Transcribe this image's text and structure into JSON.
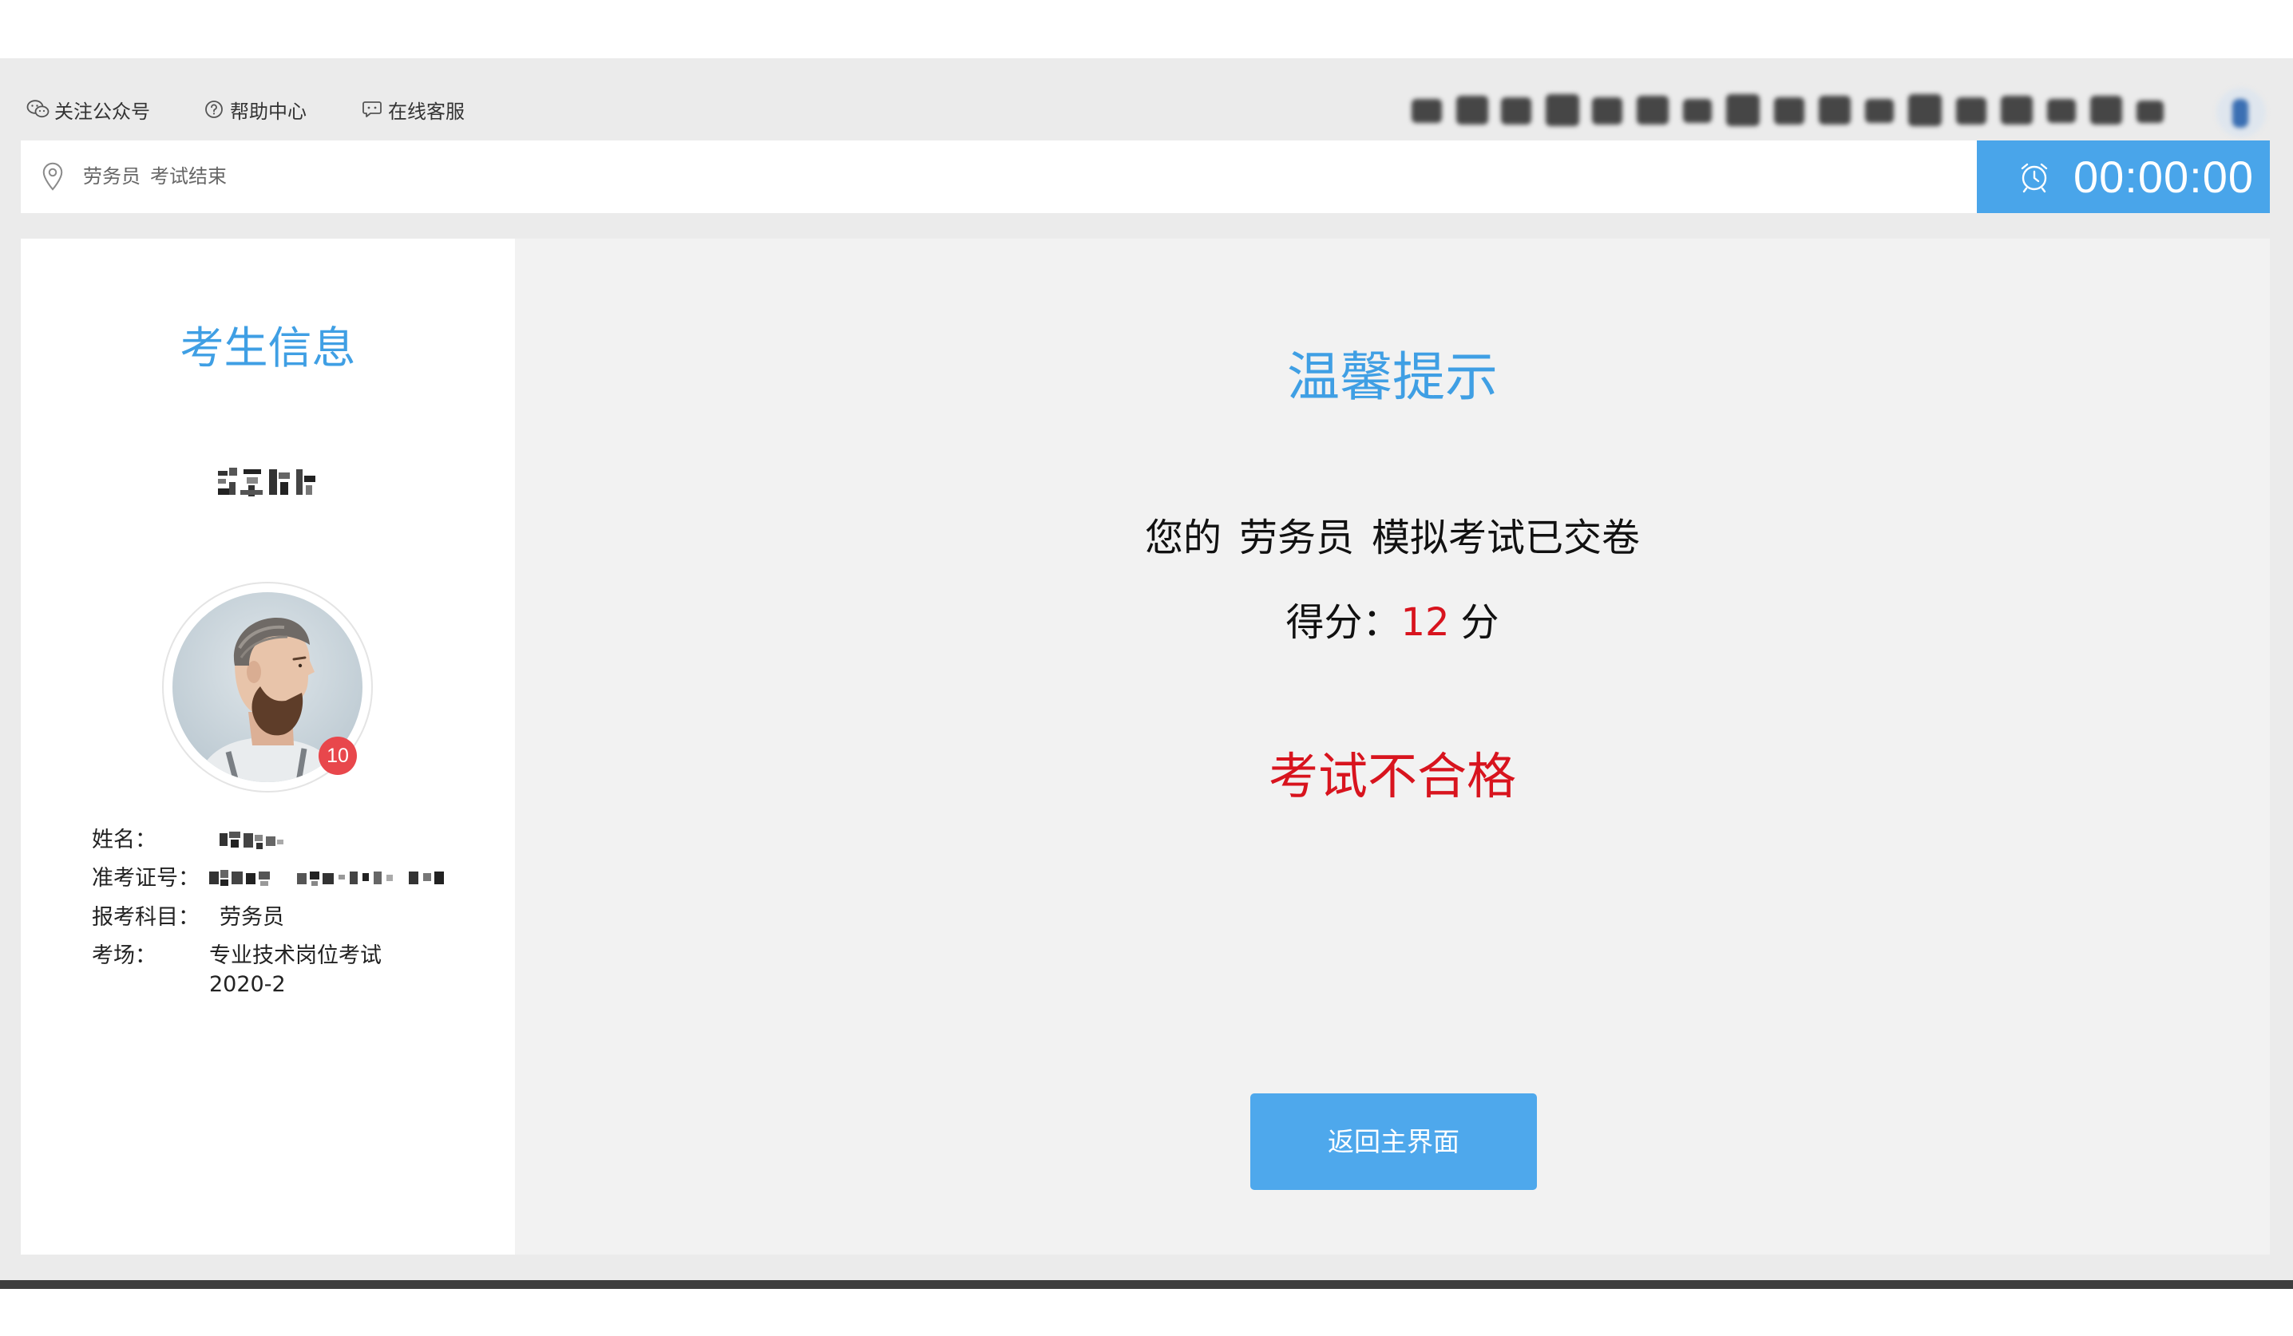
{
  "top_links": [
    {
      "label": "关注公众号",
      "icon": "wechat-icon"
    },
    {
      "label": "帮助中心",
      "icon": "help-icon"
    },
    {
      "label": "在线客服",
      "icon": "chat-icon"
    }
  ],
  "location_bar": {
    "icon": "location-pin-icon",
    "subject": "劳务员",
    "status": "考试结束"
  },
  "timer": {
    "icon": "clock-icon",
    "value": "00:00:00"
  },
  "candidate_panel": {
    "heading": "考生信息",
    "avatar_badge": "10",
    "fields": [
      {
        "label": "姓名："
      },
      {
        "label": "准考证号："
      },
      {
        "label": "报考科目：",
        "value": "劳务员"
      },
      {
        "label": "考场：",
        "value_lines": [
          "专业技术岗位考试",
          "2020-2"
        ]
      }
    ]
  },
  "notice": {
    "heading": "温馨提示",
    "message_prefix": "您的",
    "message_subject": "劳务员",
    "message_suffix": "模拟考试已交卷",
    "score_label": "得分：",
    "score_value": "12",
    "score_unit": "分",
    "result": "考试不合格"
  },
  "return_button": {
    "label": "返回主界面"
  },
  "colors": {
    "accent_blue": "#3f9fe4",
    "button_blue": "#4ea8ec",
    "fail_red": "#d8141e",
    "badge_red": "#e8474c",
    "page_bg": "#ebebeb",
    "panel_bg": "#f2f2f2"
  }
}
